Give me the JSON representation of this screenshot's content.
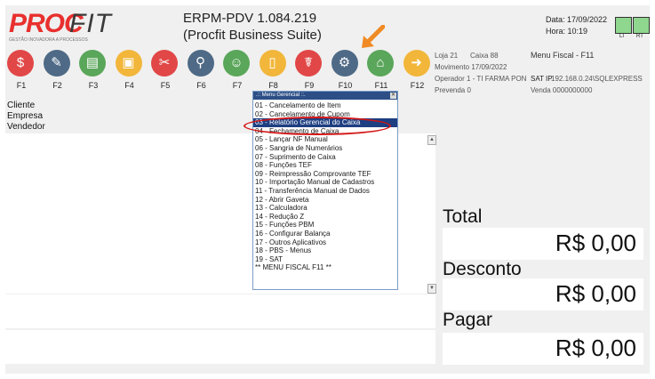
{
  "header": {
    "logo_proc": "PROC",
    "logo_fit": "FIT",
    "logo_tag": "GESTÃO INOVADORA A PROCESSOS",
    "title_line1": "ERPM-PDV 1.084.219",
    "title_line2": "(Procfit Business Suite)",
    "date": "Data: 17/09/2022",
    "time": "Hora: 10:19",
    "indicators": [
      "LI",
      "RT"
    ]
  },
  "toolbar": [
    {
      "key": "F1",
      "icon": "money-bag-icon",
      "color": "#e14747",
      "glyph": "$"
    },
    {
      "key": "F2",
      "icon": "edit-icon",
      "color": "#4f6a86",
      "glyph": "✎"
    },
    {
      "key": "F3",
      "icon": "cash-icon",
      "color": "#5aa65a",
      "glyph": "▤"
    },
    {
      "key": "F4",
      "icon": "id-card-icon",
      "color": "#f2b63a",
      "glyph": "▣"
    },
    {
      "key": "F5",
      "icon": "cancel-tag-icon",
      "color": "#e14747",
      "glyph": "✂"
    },
    {
      "key": "F6",
      "icon": "search-icon",
      "color": "#4f6a86",
      "glyph": "⚲"
    },
    {
      "key": "F7",
      "icon": "users-icon",
      "color": "#5aa65a",
      "glyph": "☺"
    },
    {
      "key": "F8",
      "icon": "phone-icon",
      "color": "#f2b63a",
      "glyph": "▯"
    },
    {
      "key": "F9",
      "icon": "pharmacy-icon",
      "color": "#e14747",
      "glyph": "☤"
    },
    {
      "key": "F10",
      "icon": "gear-icon",
      "color": "#4f6a86",
      "glyph": "⚙"
    },
    {
      "key": "F11",
      "icon": "bank-icon",
      "color": "#5aa65a",
      "glyph": "⌂"
    },
    {
      "key": "F12",
      "icon": "arrow-right-icon",
      "color": "#f2b63a",
      "glyph": "➜"
    }
  ],
  "info": {
    "loja": "Loja  21",
    "caixa": "Caixa 88",
    "menu_fiscal": "Menu Fiscal - F11",
    "movimento": "Movimento 17/09/2022",
    "operador": "Operador   1 - TI FARMA PON",
    "sat": "SAT IP",
    "sat_ip": "192.168.0.24\\SQLEXPRESS",
    "prevenda": "Prevenda  0",
    "venda": "Venda  0000000000"
  },
  "fields": {
    "cliente": "Cliente",
    "empresa": "Empresa",
    "vendedor": "Vendedor"
  },
  "totals": {
    "total_label": "Total",
    "total_value": "R$ 0,00",
    "desconto_label": "Desconto",
    "desconto_value": "R$ 0,00",
    "pagar_label": "Pagar",
    "pagar_value": "R$ 0,00"
  },
  "menu": {
    "title": ".:: Menu Gerencial ::.",
    "close": "✕",
    "items": [
      "01 - Cancelamento de Item",
      "02 - Cancelamento de Cupom",
      "03 - Relatório Gerencial do Caixa",
      "04 - Fechamento de Caixa",
      "05 - Lançar NF Manual",
      "06 - Sangria de Numerários",
      "07 - Suprimento de Caixa",
      "08 - Funções TEF",
      "09 - Reimpressão Comprovante TEF",
      "10 - Importação Manual de Cadastros",
      "11 - Transferência Manual de Dados",
      "12 - Abrir Gaveta",
      "13 - Calculadora",
      "14 - Redução Z",
      "15 - Funções PBM",
      "16 - Configurar Balança",
      "17 - Outros Aplicativos",
      "18 - PBS - Menus",
      "19 - SAT",
      "** MENU FISCAL F11 **"
    ],
    "selected_index": 2
  }
}
